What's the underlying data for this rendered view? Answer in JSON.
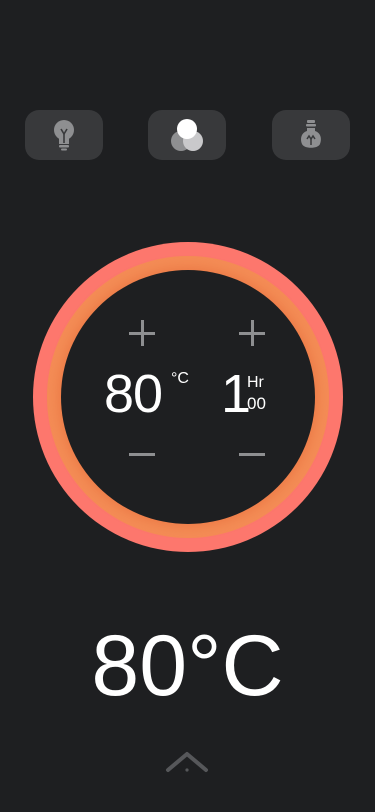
{
  "modes": [
    {
      "id": "bulb",
      "icon": "lightbulb-icon"
    },
    {
      "id": "color",
      "icon": "color-mix-icon"
    },
    {
      "id": "lab",
      "icon": "lab-bulb-icon"
    }
  ],
  "dial": {
    "temperature_value": "80",
    "temperature_unit": "°C",
    "time_value": "1",
    "time_unit": "Hr",
    "time_minutes": "00"
  },
  "display": {
    "temperature": "80°C"
  },
  "colors": {
    "background": "#1e1f21",
    "button_bg": "#38393b",
    "ring_accent": "#fd776d",
    "ring_glow": "#f48c55",
    "control_gray": "#8e8f91"
  }
}
